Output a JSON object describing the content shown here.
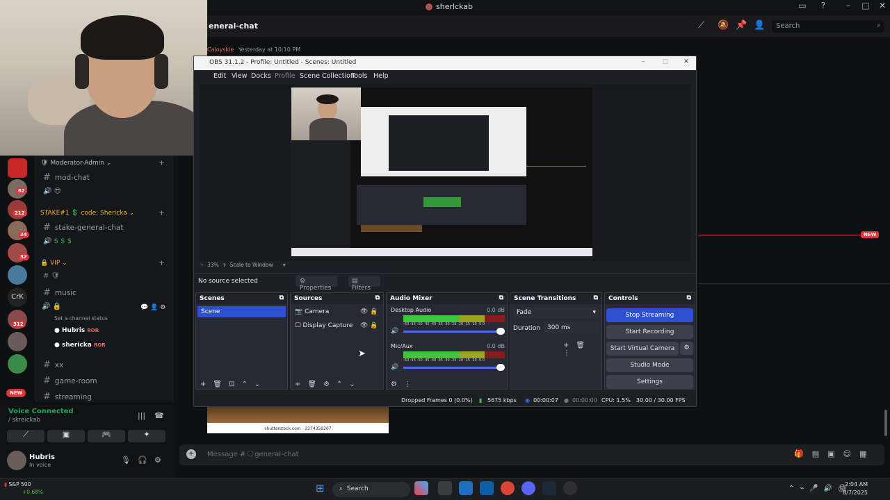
{
  "discord": {
    "window_title": "sherlckab",
    "channel_name": "eneral-chat",
    "search_placeholder": "Search",
    "message_placeholder": "Message #🗨general-chat",
    "new_badge": "NEW",
    "message_header": {
      "author": "Caloyskie",
      "time": "Yesterday at 10:10 PM"
    },
    "categories": [
      {
        "label": "Moderator-Admin"
      },
      {
        "label": "STAKE#1 💲 code: Shericka"
      },
      {
        "label": "VIP"
      }
    ],
    "channels": [
      {
        "label": "mod-chat"
      },
      {
        "label": "stake-general-chat"
      },
      {
        "label": "music"
      },
      {
        "label": "xx"
      },
      {
        "label": "game-room"
      },
      {
        "label": "streaming"
      }
    ],
    "channel_status_hint": "Set a channel status",
    "voice_users": [
      {
        "name": "Hubris",
        "badge": "ROR"
      },
      {
        "name": "shericka",
        "badge": "ROR"
      }
    ],
    "voice_connected": {
      "title": "Voice Connected",
      "channel": "/ skreickab"
    },
    "user": {
      "name": "Hubris",
      "status": "In voice"
    },
    "server_badges": [
      "62",
      "212",
      "24",
      "32",
      "312"
    ],
    "server_crk": "CrK",
    "server_new": "NEW",
    "shutter_caption": "shutterstock.com · 2274359207"
  },
  "obs": {
    "title": "OBS 31.1.2 - Profile: Untitled - Scenes: Untitled",
    "menu": [
      "Edit",
      "View",
      "Docks",
      "Profile",
      "Scene Collection",
      "Tools",
      "Help"
    ],
    "zoom": "33%",
    "scale_label": "Scale to Window",
    "no_source": "No source selected",
    "properties": "Properties",
    "filters": "Filters",
    "scenes": {
      "title": "Scenes",
      "items": [
        "Scene"
      ]
    },
    "sources": {
      "title": "Sources",
      "items": [
        "Camera",
        "Display Capture"
      ]
    },
    "mixer": {
      "title": "Audio Mixer",
      "channels": [
        {
          "name": "Desktop Audio",
          "db": "0.0 dB"
        },
        {
          "name": "Mic/Aux",
          "db": "0.0 dB"
        }
      ],
      "scale": "-60 -55 -50 -45 -40 -35 -30 -25 -20 -15 -10 -5 0"
    },
    "transitions": {
      "title": "Scene Transitions",
      "type": "Fade",
      "duration_label": "Duration",
      "duration": "300 ms"
    },
    "controls": {
      "title": "Controls",
      "stop_streaming": "Stop Streaming",
      "start_recording": "Start Recording",
      "virtual_camera": "Start Virtual Camera",
      "studio_mode": "Studio Mode",
      "settings": "Settings"
    },
    "status": {
      "dropped": "Dropped Frames 0 (0.0%)",
      "bitrate": "5675 kbps",
      "stream_time": "00:00:07",
      "rec_time": "00:00:00",
      "cpu": "CPU: 1.5%",
      "fps": "30.00 / 30.00 FPS"
    }
  },
  "taskbar": {
    "search": "Search",
    "stock": {
      "name": "S&P 500",
      "change": "+0.68%"
    },
    "time": "2:04 AM",
    "date": "8/7/2025"
  }
}
